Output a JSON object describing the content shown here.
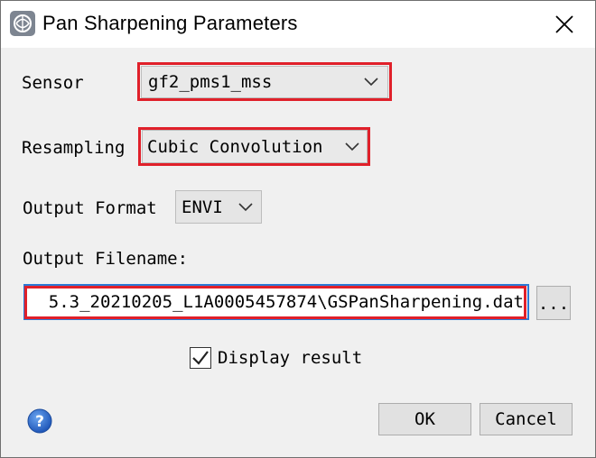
{
  "window": {
    "title": "Pan Sharpening Parameters",
    "app_icon": "app-logo-icon",
    "close_icon": "close-icon"
  },
  "sensor": {
    "label": "Sensor",
    "value": "gf2_pms1_mss"
  },
  "resampling": {
    "label": "Resampling",
    "value": "Cubic Convolution"
  },
  "output_format": {
    "label": "Output Format",
    "value": "ENVI"
  },
  "output_filename": {
    "label": "Output Filename:",
    "value": "5.3_20210205_L1A0005457874\\GSPanSharpening.dat",
    "browse_label": "..."
  },
  "display_result": {
    "label": "Display result",
    "checked": true
  },
  "buttons": {
    "ok": "OK",
    "cancel": "Cancel"
  },
  "colors": {
    "highlight": "#e0202a",
    "focus": "#2b79d6",
    "help": "#2f6fd6"
  },
  "icons": {
    "help": "help-icon",
    "chevron": "chevron-down-icon",
    "check": "checkmark-icon"
  }
}
